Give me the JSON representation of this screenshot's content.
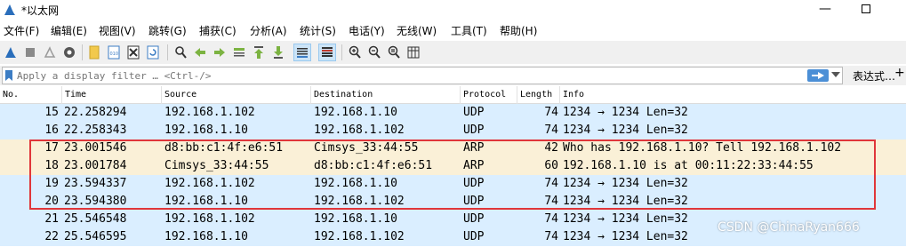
{
  "window": {
    "title": "*以太网",
    "minimize_glyph": "—"
  },
  "menu": [
    {
      "label": "文件(F)"
    },
    {
      "label": "编辑(E)"
    },
    {
      "label": "视图(V)"
    },
    {
      "label": "跳转(G)"
    },
    {
      "label": "捕获(C)"
    },
    {
      "label": "分析(A)"
    },
    {
      "label": "统计(S)"
    },
    {
      "label": "电话(Y)"
    },
    {
      "label": "无线(W)"
    },
    {
      "label": "工具(T)"
    },
    {
      "label": "帮助(H)"
    }
  ],
  "toolbar_icons": [
    "start-capture-icon",
    "stop-capture-icon",
    "restart-capture-icon",
    "capture-options-icon",
    "open-file-icon",
    "save-file-icon",
    "close-file-icon",
    "reload-file-icon",
    "find-packet-icon",
    "go-back-icon",
    "go-forward-icon",
    "go-to-packet-icon",
    "go-first-icon",
    "go-last-icon",
    "auto-scroll-icon",
    "colorize-icon",
    "zoom-in-icon",
    "zoom-out-icon",
    "zoom-normal-icon",
    "resize-columns-icon"
  ],
  "filter": {
    "placeholder": "Apply a display filter … <Ctrl-/>",
    "expression_label": "表达式…",
    "add_label": "+"
  },
  "columns": [
    "No.",
    "Time",
    "Source",
    "Destination",
    "Protocol",
    "Length",
    "Info"
  ],
  "packets": [
    {
      "no": "15",
      "time": "22.258294",
      "src": "192.168.1.102",
      "dst": "192.168.1.10",
      "proto": "UDP",
      "len": "74",
      "info": "1234 → 1234 Len=32",
      "kind": "udp"
    },
    {
      "no": "16",
      "time": "22.258343",
      "src": "192.168.1.10",
      "dst": "192.168.1.102",
      "proto": "UDP",
      "len": "74",
      "info": "1234 → 1234 Len=32",
      "kind": "udp"
    },
    {
      "no": "17",
      "time": "23.001546",
      "src": "d8:bb:c1:4f:e6:51",
      "dst": "Cimsys_33:44:55",
      "proto": "ARP",
      "len": "42",
      "info": "Who has 192.168.1.10? Tell 192.168.1.102",
      "kind": "arp"
    },
    {
      "no": "18",
      "time": "23.001784",
      "src": "Cimsys_33:44:55",
      "dst": "d8:bb:c1:4f:e6:51",
      "proto": "ARP",
      "len": "60",
      "info": "192.168.1.10 is at 00:11:22:33:44:55",
      "kind": "arp"
    },
    {
      "no": "19",
      "time": "23.594337",
      "src": "192.168.1.102",
      "dst": "192.168.1.10",
      "proto": "UDP",
      "len": "74",
      "info": "1234 → 1234 Len=32",
      "kind": "udp"
    },
    {
      "no": "20",
      "time": "23.594380",
      "src": "192.168.1.10",
      "dst": "192.168.1.102",
      "proto": "UDP",
      "len": "74",
      "info": "1234 → 1234 Len=32",
      "kind": "udp"
    },
    {
      "no": "21",
      "time": "25.546548",
      "src": "192.168.1.102",
      "dst": "192.168.1.10",
      "proto": "UDP",
      "len": "74",
      "info": "1234 → 1234 Len=32",
      "kind": "udp"
    },
    {
      "no": "22",
      "time": "25.546595",
      "src": "192.168.1.10",
      "dst": "192.168.1.102",
      "proto": "UDP",
      "len": "74",
      "info": "1234 → 1234 Len=32",
      "kind": "udp"
    }
  ],
  "colors": {
    "udp_row": "#daeeff",
    "arp_row": "#faf0d7",
    "highlight_border": "#e0363a"
  },
  "watermark": "CSDN @ChinaRyan666"
}
